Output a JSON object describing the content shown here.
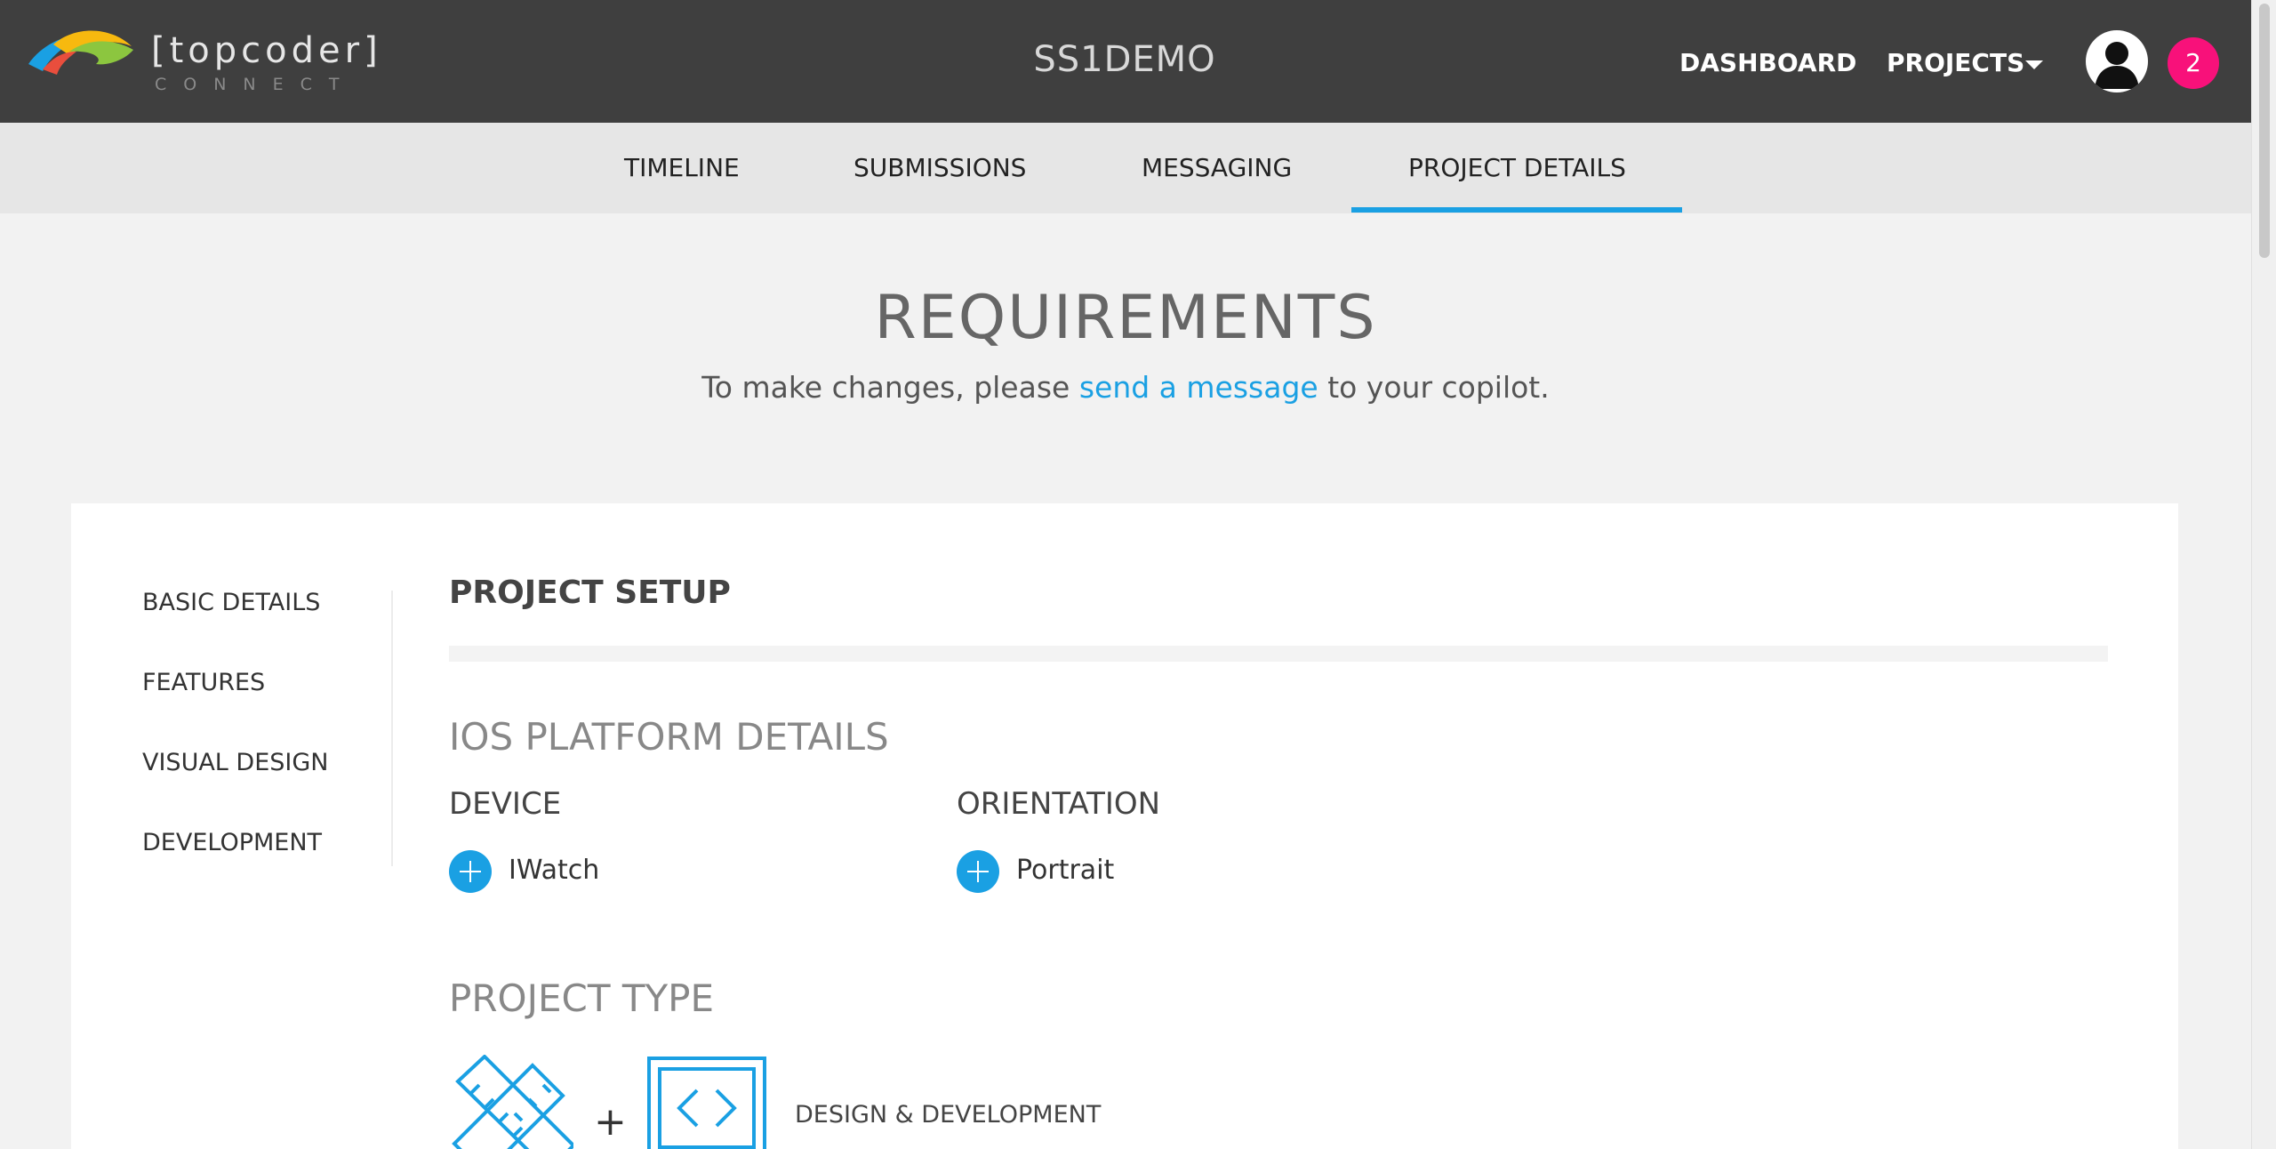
{
  "header": {
    "logo_text": "[topcoder]",
    "logo_sub": "CONNECT",
    "project_name": "SS1DEMO",
    "nav": {
      "dashboard": "DASHBOARD",
      "projects": "PROJECTS"
    },
    "notification_count": "2"
  },
  "tabs": {
    "timeline": "TIMELINE",
    "submissions": "SUBMISSIONS",
    "messaging": "MESSAGING",
    "project_details": "PROJECT DETAILS",
    "active": "PROJECT DETAILS"
  },
  "requirements": {
    "title": "REQUIREMENTS",
    "sub_before": "To make changes, please ",
    "sub_link": "send a message",
    "sub_after": " to your copilot."
  },
  "sidebar": {
    "items": [
      {
        "label": "BASIC DETAILS"
      },
      {
        "label": "FEATURES"
      },
      {
        "label": "VISUAL DESIGN"
      },
      {
        "label": "DEVELOPMENT"
      }
    ]
  },
  "main": {
    "section_title": "PROJECT SETUP",
    "platform_title": "IOS PLATFORM DETAILS",
    "device": {
      "label": "DEVICE",
      "value": "IWatch"
    },
    "orientation": {
      "label": "ORIENTATION",
      "value": "Portrait"
    },
    "project_type": {
      "title": "PROJECT TYPE",
      "plus": "+",
      "label": "DESIGN & DEVELOPMENT"
    }
  },
  "colors": {
    "accent": "#1aa0e3",
    "topbar": "#3f3f3f",
    "badge": "#f8117a",
    "background": "#f2f2f2"
  },
  "icons": [
    "topcoder-logo-icon",
    "chevron-down-icon",
    "user-avatar-icon",
    "plus-circle-icon",
    "design-tools-icon",
    "code-window-icon"
  ]
}
